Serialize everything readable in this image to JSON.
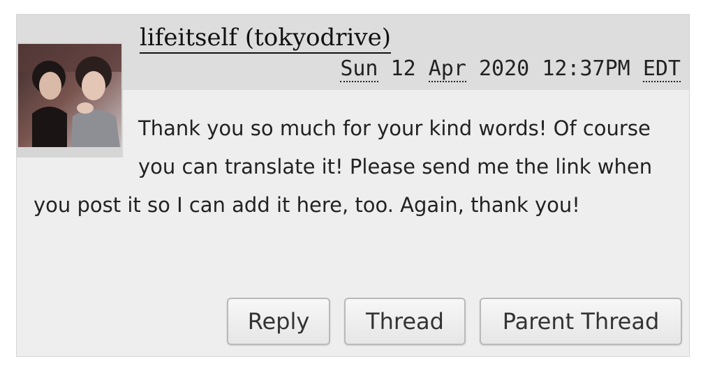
{
  "comment": {
    "poster": "lifeitself (tokyodrive)",
    "date": {
      "weekday": "Sun",
      "day": "12",
      "month": "Apr",
      "year": "2020",
      "time": "12:37PM",
      "timezone": "EDT"
    },
    "body": "Thank you so much for your kind words! Of course you can translate it! Please send me the link when you post it so I can add it here, too. Again, thank you!",
    "userpic_icon": "userpic-photo-icon"
  },
  "actions": {
    "reply_label": "Reply",
    "thread_label": "Thread",
    "parent_thread_label": "Parent Thread"
  },
  "colors": {
    "header_background": "#dddddd",
    "comment_background": "#eeeeee",
    "text": "#222222"
  }
}
